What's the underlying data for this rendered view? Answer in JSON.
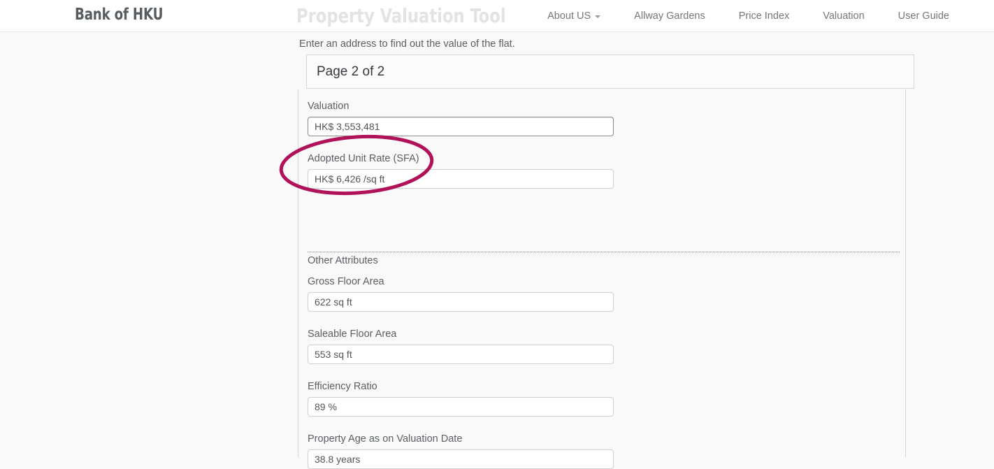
{
  "navbar": {
    "brand": "Bank of HKU",
    "app_title": "Property Valuation Tool",
    "links": [
      {
        "label": "About US",
        "has_caret": true,
        "icon": "chevron-down-icon"
      },
      {
        "label": "Allway Gardens",
        "has_caret": false
      },
      {
        "label": "Price Index",
        "has_caret": false
      },
      {
        "label": "Valuation",
        "has_caret": false
      },
      {
        "label": "User Guide",
        "has_caret": false
      }
    ]
  },
  "page": {
    "intro": "Enter an address to find out the value of the flat.",
    "panel_title": "Page 2 of 2",
    "section_label": "Other Attributes"
  },
  "fields": [
    {
      "label": "Valuation",
      "value": "HK$ 3,553,481",
      "focused": true
    },
    {
      "label": "Adopted Unit Rate (SFA)",
      "value": "HK$ 6,426 /sq ft",
      "focused": false
    },
    {
      "label": "Gross Floor Area",
      "value": "622 sq ft",
      "focused": false
    },
    {
      "label": "Saleable Floor Area",
      "value": "553 sq ft",
      "focused": false
    },
    {
      "label": "Efficiency Ratio",
      "value": "89 %",
      "focused": false
    },
    {
      "label": "Property Age as on Valuation Date",
      "value": "38.8 years",
      "focused": false
    }
  ],
  "annotation": {
    "shape": "ellipse",
    "color": "#b01158",
    "stroke_width": 5,
    "targets": "valuation-field"
  },
  "colors": {
    "page_background": "#f9f9f9",
    "navbar_background": "#ffffff",
    "brand_text": "#565c5f",
    "app_title_text": "#e3e3e5",
    "label_text": "#5b5f63",
    "input_text": "#555555",
    "panel_border": "#d6d6d6",
    "annotation": "#b01158"
  }
}
